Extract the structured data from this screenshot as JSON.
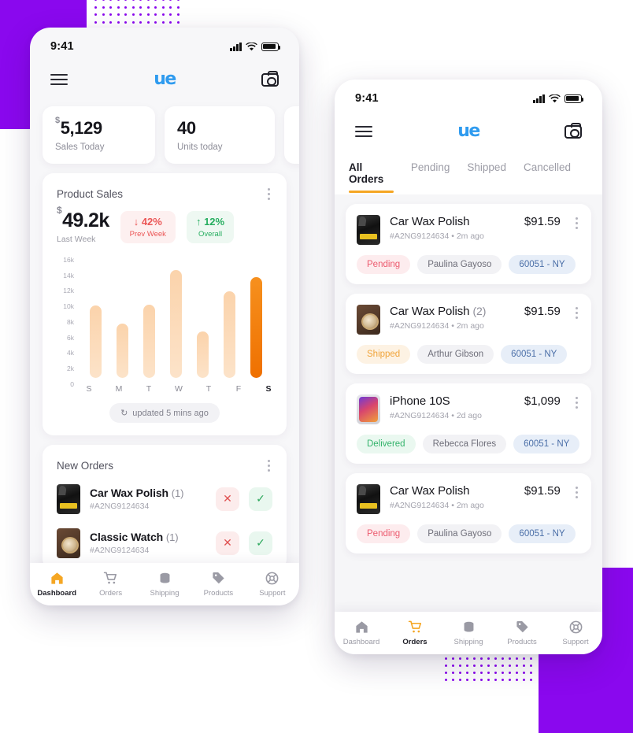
{
  "colors": {
    "brand_purple": "#8A08EE",
    "logo_blue": "#2F9BEF",
    "accent_orange": "#F5A623",
    "bar_highlight": "#EF7000",
    "bar_light": "#FBD3AB",
    "danger": "#EB5757",
    "success": "#27AE60"
  },
  "left_phone": {
    "status_bar": {
      "time": "9:41",
      "signal_icon": "signal-bars-icon",
      "wifi_icon": "wifi-icon",
      "battery_icon": "battery-icon"
    },
    "app_bar": {
      "menu_icon": "hamburger-menu-icon",
      "logo": "ue",
      "camera_icon": "camera-icon"
    },
    "kpis": [
      {
        "prefix": "$",
        "value": "5,129",
        "label": "Sales Today"
      },
      {
        "prefix": "",
        "value": "40",
        "label": "Units today"
      }
    ],
    "product_sales": {
      "title": "Product Sales",
      "menu_icon": "kebab-menu-icon",
      "total_prefix": "$",
      "total": "49.2k",
      "total_label": "Last Week",
      "badges": [
        {
          "arrow": "↓",
          "value": "42%",
          "label": "Prev Week",
          "tone": "down"
        },
        {
          "arrow": "↑",
          "value": "12%",
          "label": "Overall",
          "tone": "up"
        }
      ],
      "updated_icon": "refresh-icon",
      "updated_text": "updated 5 mins ago"
    },
    "new_orders": {
      "title": "New Orders",
      "menu_icon": "kebab-menu-icon",
      "rows": [
        {
          "thumb": "spray-bottle-image",
          "name": "Car Wax Polish",
          "qty": "(1)",
          "id": "#A2NG9124634",
          "reject_icon": "close-icon",
          "accept_icon": "check-icon"
        },
        {
          "thumb": "watch-image",
          "name": "Classic Watch",
          "qty": "(1)",
          "id": "#A2NG9124634",
          "reject_icon": "close-icon",
          "accept_icon": "check-icon"
        }
      ]
    },
    "tabbar": {
      "items": [
        {
          "label": "Dashboard",
          "icon": "home-icon",
          "active": true
        },
        {
          "label": "Orders",
          "icon": "cart-icon",
          "active": false
        },
        {
          "label": "Shipping",
          "icon": "box-icon",
          "active": false
        },
        {
          "label": "Products",
          "icon": "tag-icon",
          "active": false
        },
        {
          "label": "Support",
          "icon": "lifebuoy-icon",
          "active": false
        }
      ]
    }
  },
  "right_phone": {
    "status_bar": {
      "time": "9:41",
      "signal_icon": "signal-bars-icon",
      "wifi_icon": "wifi-icon",
      "battery_icon": "battery-icon"
    },
    "app_bar": {
      "menu_icon": "hamburger-menu-icon",
      "logo": "ue",
      "camera_icon": "camera-icon"
    },
    "tabs": [
      {
        "label": "All Orders",
        "active": true
      },
      {
        "label": "Pending",
        "active": false
      },
      {
        "label": "Shipped",
        "active": false
      },
      {
        "label": "Cancelled",
        "active": false
      }
    ],
    "orders": [
      {
        "thumb": "spray-bottle-image",
        "name": "Car Wax Polish",
        "qty": "",
        "id": "#A2NG9124634",
        "dot": "•",
        "time": "2m ago",
        "price": "$91.59",
        "menu_icon": "kebab-menu-icon",
        "status": "Pending",
        "status_tone": "pending",
        "person": "Paulina Gayoso",
        "zip": "60051 - NY"
      },
      {
        "thumb": "watch-image",
        "name": "Car Wax Polish",
        "qty": "(2)",
        "id": "#A2NG9124634",
        "dot": "•",
        "time": "2m ago",
        "price": "$91.59",
        "menu_icon": "kebab-menu-icon",
        "status": "Shipped",
        "status_tone": "shipped",
        "person": "Arthur Gibson",
        "zip": "60051 - NY"
      },
      {
        "thumb": "iphone-image",
        "name": "iPhone 10S",
        "qty": "",
        "id": "#A2NG9124634",
        "dot": "•",
        "time": "2d ago",
        "price": "$1,099",
        "menu_icon": "kebab-menu-icon",
        "status": "Delivered",
        "status_tone": "delivered",
        "person": "Rebecca Flores",
        "zip": "60051 - NY"
      },
      {
        "thumb": "spray-bottle-image",
        "name": "Car Wax Polish",
        "qty": "",
        "id": "#A2NG9124634",
        "dot": "•",
        "time": "2m ago",
        "price": "$91.59",
        "menu_icon": "kebab-menu-icon",
        "status": "Pending",
        "status_tone": "pending",
        "person": "Paulina Gayoso",
        "zip": "60051 - NY"
      }
    ],
    "tabbar": {
      "items": [
        {
          "label": "Dashboard",
          "icon": "home-icon",
          "active": false
        },
        {
          "label": "Orders",
          "icon": "cart-icon",
          "active": true
        },
        {
          "label": "Shipping",
          "icon": "box-icon",
          "active": false
        },
        {
          "label": "Products",
          "icon": "tag-icon",
          "active": false
        },
        {
          "label": "Support",
          "icon": "lifebuoy-icon",
          "active": false
        }
      ]
    }
  },
  "chart_data": {
    "type": "bar",
    "title": "Product Sales",
    "categories": [
      "S",
      "M",
      "T",
      "W",
      "T",
      "F",
      "S"
    ],
    "values": [
      10000,
      7500,
      10200,
      15000,
      6500,
      12000,
      14000
    ],
    "highlight_index": 6,
    "ytick_labels": [
      "16k",
      "14k",
      "12k",
      "10k",
      "8k",
      "6k",
      "4k",
      "2k",
      "0"
    ],
    "yticks": [
      16000,
      14000,
      12000,
      10000,
      8000,
      6000,
      4000,
      2000,
      0
    ],
    "ylim": [
      0,
      16800
    ],
    "xlabel": "",
    "ylabel": "",
    "grid": false,
    "legend": false
  }
}
